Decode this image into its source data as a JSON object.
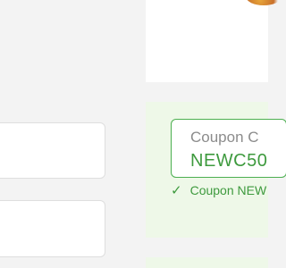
{
  "coupon": {
    "field_label": "Coupon C",
    "code_value": "NEWC50",
    "applied_message": "Coupon NEW",
    "accent_color": "#4caf50"
  },
  "icons": {
    "applied": "check-icon"
  }
}
